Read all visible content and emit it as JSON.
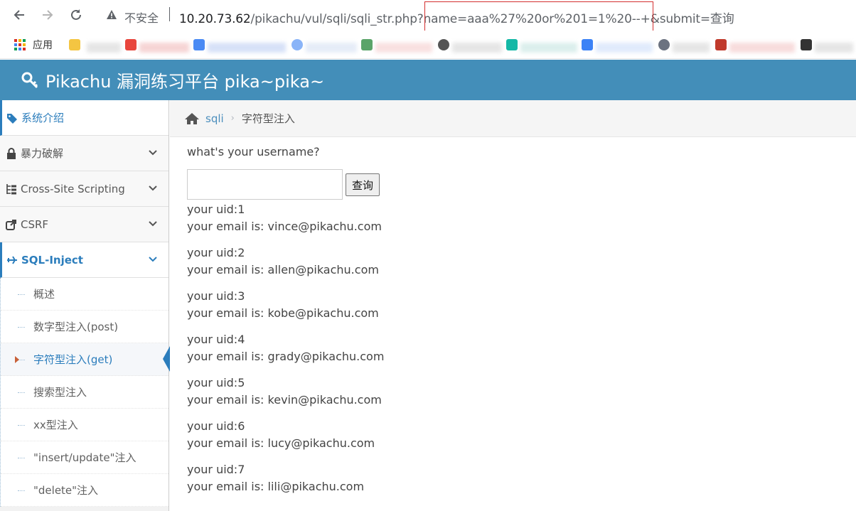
{
  "browser": {
    "back_icon": "arrow-left-icon",
    "forward_icon": "arrow-right-icon",
    "reload_icon": "reload-icon",
    "security_label": "不安全",
    "url_host": "10.20.73.62",
    "url_path": "/pikachu/vul/sqli/sqli_str.php?name=aaa%27%20or%201=1%20--+&submit=查询"
  },
  "bookmarks": {
    "apps_label": "应用"
  },
  "header": {
    "title": "Pikachu 漏洞练习平台 pika~pika~",
    "accent": "#438eb9"
  },
  "sidebar": {
    "items": [
      {
        "label": "系统介绍",
        "icon": "tags-icon"
      },
      {
        "label": "暴力破解",
        "icon": "lock-icon"
      },
      {
        "label": "Cross-Site Scripting",
        "icon": "tree-icon"
      },
      {
        "label": "CSRF",
        "icon": "share-icon"
      },
      {
        "label": "SQL-Inject",
        "icon": "plane-icon"
      }
    ],
    "sub_items": [
      {
        "label": "概述"
      },
      {
        "label": "数字型注入(post)"
      },
      {
        "label": "字符型注入(get)"
      },
      {
        "label": "搜索型注入"
      },
      {
        "label": "xx型注入"
      },
      {
        "label": "\"insert/update\"注入"
      },
      {
        "label": "\"delete\"注入"
      }
    ]
  },
  "breadcrumb": {
    "home_icon": "home-icon",
    "link": "sqli",
    "current": "字符型注入"
  },
  "main": {
    "question": "what's your username?",
    "input_value": "",
    "button_label": "查询",
    "results": [
      {
        "uid": "your uid:1",
        "email": "your email is: vince@pikachu.com"
      },
      {
        "uid": "your uid:2",
        "email": "your email is: allen@pikachu.com"
      },
      {
        "uid": "your uid:3",
        "email": "your email is: kobe@pikachu.com"
      },
      {
        "uid": "your uid:4",
        "email": "your email is: grady@pikachu.com"
      },
      {
        "uid": "your uid:5",
        "email": "your email is: kevin@pikachu.com"
      },
      {
        "uid": "your uid:6",
        "email": "your email is: lucy@pikachu.com"
      },
      {
        "uid": "your uid:7",
        "email": "your email is: lili@pikachu.com"
      }
    ]
  }
}
